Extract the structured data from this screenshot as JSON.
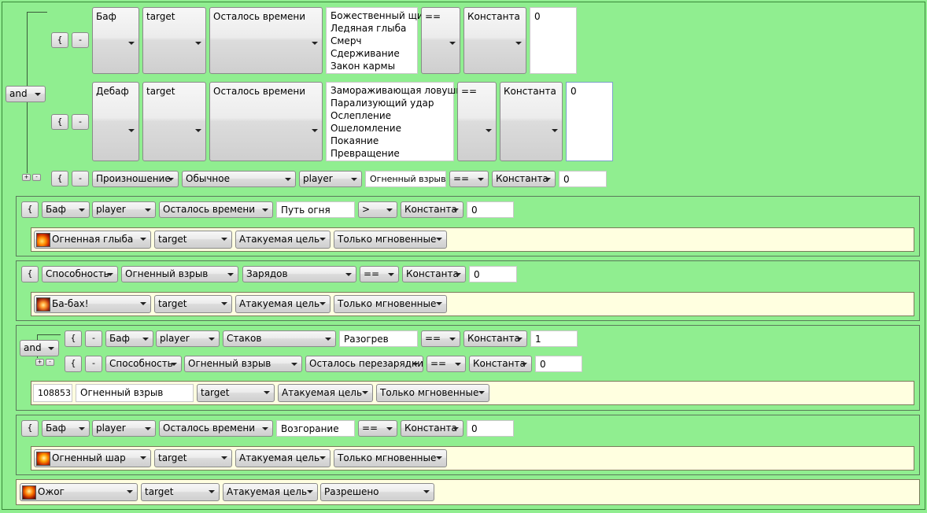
{
  "group1": {
    "logic": "and",
    "row1": {
      "brace": "{",
      "minus": "-",
      "type": "Баф",
      "target": "target",
      "param": "Осталось времени",
      "list": [
        "Божественный щит",
        "Ледяная глыба",
        "Смерч",
        "Сдерживание",
        "Закон кармы"
      ],
      "op": "==",
      "kind": "Константа",
      "value": "0"
    },
    "row2": {
      "brace": "{",
      "minus": "-",
      "type": "Дебаф",
      "target": "target",
      "param": "Осталось времени",
      "list": [
        "Замораживающая ловушка",
        "Парализующий удар",
        "Ослепление",
        "Ошеломление",
        "Покаяние",
        "Превращение"
      ],
      "op": "==",
      "kind": "Константа",
      "value": "0"
    },
    "row3": {
      "brace": "{",
      "minus": "-",
      "type": "Произношение",
      "mode": "Обычное",
      "target": "player",
      "spell": "Огненный взрыв",
      "op": "==",
      "kind": "Константа",
      "value": "0"
    }
  },
  "rule1": {
    "cond": {
      "brace": "{",
      "type": "Баф",
      "target": "player",
      "param": "Осталось времени",
      "spell": "Путь огня",
      "op": ">",
      "kind": "Константа",
      "value": "0"
    },
    "action": {
      "spell": "Огненная глыба",
      "icon": "fire-block-icon",
      "target": "target",
      "who": "Атакуемая цель",
      "cast": "Только мгновенные"
    }
  },
  "rule2": {
    "cond": {
      "brace": "{",
      "type": "Способность",
      "spell": "Огненный взрыв",
      "param": "Зарядов",
      "op": "==",
      "kind": "Константа",
      "value": "0"
    },
    "action": {
      "spell": "Ба-бах!",
      "icon": "ba-bah-icon",
      "target": "target",
      "who": "Атакуемая цель",
      "cast": "Только мгновенные"
    }
  },
  "rule3": {
    "logic": "and",
    "cond1": {
      "brace": "{",
      "minus": "-",
      "type": "Баф",
      "target": "player",
      "param": "Стаков",
      "spell": "Разогрев",
      "op": "==",
      "kind": "Константа",
      "value": "1"
    },
    "cond2": {
      "brace": "{",
      "minus": "-",
      "type": "Способность",
      "spell": "Огненный взрыв",
      "param": "Осталось перезарядки",
      "op": "==",
      "kind": "Константа",
      "value": "0"
    },
    "action": {
      "spell_id": "108853",
      "spell": "Огненный взрыв",
      "target": "target",
      "who": "Атакуемая цель",
      "cast": "Только мгновенные"
    }
  },
  "rule4": {
    "cond": {
      "brace": "{",
      "type": "Баф",
      "target": "player",
      "param": "Осталось времени",
      "spell": "Возгорание",
      "op": "==",
      "kind": "Константа",
      "value": "0"
    },
    "action": {
      "spell": "Огненный шар",
      "icon": "fireball-icon",
      "target": "target",
      "who": "Атакуемая цель",
      "cast": "Только мгновенные"
    }
  },
  "rule5": {
    "action": {
      "spell": "Ожог",
      "icon": "scorch-icon",
      "target": "target",
      "who": "Атакуемая цель",
      "cast": "Разрешено"
    }
  }
}
